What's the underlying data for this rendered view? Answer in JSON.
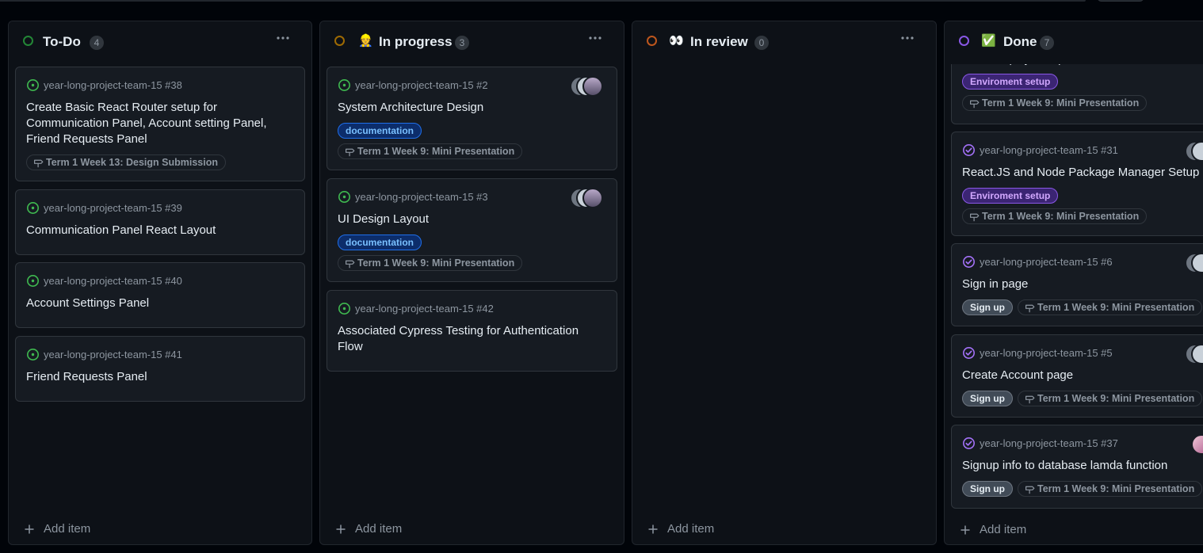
{
  "columns": {
    "todo": {
      "title": "To-Do",
      "count": "4",
      "add_label": "Add item",
      "cards": [
        {
          "repo": "year-long-project-team-15 #38",
          "title": "Create Basic React Router setup for Communication Panel, Account setting Panel, Friend Requests Panel",
          "milestone": "Term 1 Week 13: Design Submission"
        },
        {
          "repo": "year-long-project-team-15 #39",
          "title": "Communication Panel React Layout"
        },
        {
          "repo": "year-long-project-team-15 #40",
          "title": "Account Settings Panel"
        },
        {
          "repo": "year-long-project-team-15 #41",
          "title": "Friend Requests Panel"
        }
      ]
    },
    "in_progress": {
      "emoji": "👷",
      "title": "In progress",
      "count": "3",
      "add_label": "Add item",
      "cards": [
        {
          "repo": "year-long-project-team-15 #2",
          "title": "System Architecture Design",
          "label": "documentation",
          "milestone": "Term 1 Week 9: Mini Presentation"
        },
        {
          "repo": "year-long-project-team-15 #3",
          "title": "UI Design Layout",
          "label": "documentation",
          "milestone": "Term 1 Week 9: Mini Presentation"
        },
        {
          "repo": "year-long-project-team-15 #42",
          "title": "Associated Cypress Testing for Authentication Flow"
        }
      ]
    },
    "in_review": {
      "emoji": "👀",
      "title": "In review",
      "count": "0",
      "add_label": "Add item"
    },
    "done": {
      "emoji": "✅",
      "title": "Done",
      "count": "7",
      "add_label": "Add item",
      "cards": [
        {
          "title": "AWS Amplify Setup",
          "label": "Enviroment setup",
          "milestone": "Term 1 Week 9: Mini Presentation"
        },
        {
          "repo": "year-long-project-team-15 #31",
          "title": "React.JS and Node Package Manager Setup",
          "label": "Enviroment setup",
          "milestone": "Term 1 Week 9: Mini Presentation"
        },
        {
          "repo": "year-long-project-team-15 #6",
          "title": "Sign in page",
          "label": "Sign up",
          "milestone": "Term 1 Week 9: Mini Presentation"
        },
        {
          "repo": "year-long-project-team-15 #5",
          "title": "Create Account page",
          "label": "Sign up",
          "milestone": "Term 1 Week 9: Mini Presentation"
        },
        {
          "repo": "year-long-project-team-15 #37",
          "title": "Signup info to database lamda function",
          "label": "Sign up",
          "milestone": "Term 1 Week 9: Mini Presentation"
        }
      ]
    }
  },
  "colors": {
    "background": "#010409",
    "column": "#0d1117",
    "card": "#161b22",
    "open_issue": "#3fb950",
    "closed_issue": "#a371f7",
    "todo_status": "#238636",
    "progress_status": "#9e6a03",
    "review_status": "#bd561d",
    "done_status": "#8957e5"
  },
  "icons": {
    "open_issue": "issue-opened-icon",
    "closed_issue": "issue-closed-icon",
    "milestone": "milestone-icon",
    "more": "kebab-horizontal-icon",
    "add": "plus-icon"
  }
}
